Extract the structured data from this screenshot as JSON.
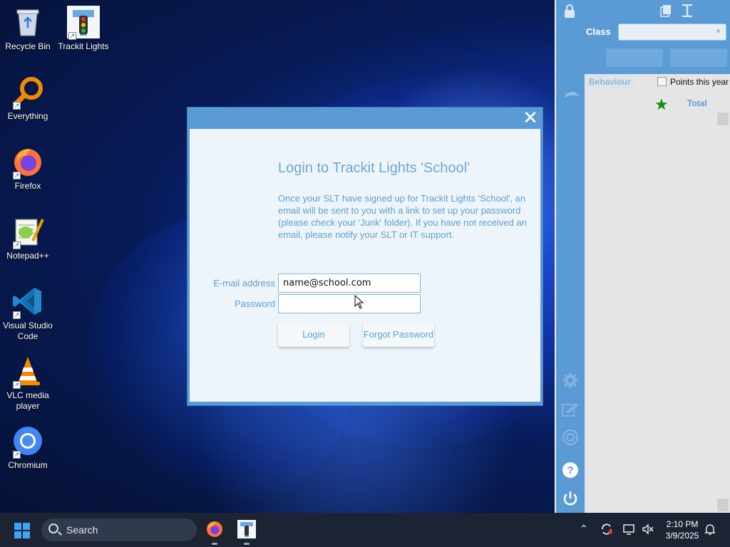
{
  "desktop": {
    "icons": [
      {
        "label": "Recycle Bin",
        "icon": "recycle-bin-icon"
      },
      {
        "label": "Trackit Lights",
        "icon": "traffic-light-icon"
      },
      {
        "label": "Everything",
        "icon": "magnifier-icon"
      },
      {
        "label": "Firefox",
        "icon": "firefox-icon"
      },
      {
        "label": "Notepad++",
        "icon": "notepad-plus-plus-icon"
      },
      {
        "label": "Visual Studio Code",
        "icon": "vscode-icon"
      },
      {
        "label": "VLC media player",
        "icon": "vlc-cone-icon"
      },
      {
        "label": "Chromium",
        "icon": "chromium-icon"
      }
    ]
  },
  "dialog": {
    "title": "Login to Trackit Lights 'School'",
    "message": "Once your SLT have signed up for Trackit Lights 'School', an email will be sent to you with a link to set up your password (please check your 'Junk' folder). If you have not received an email, please notify your SLT or IT support.",
    "email_label": "E-mail address",
    "email_value": "name@school.com",
    "password_label": "Password",
    "password_value": "",
    "login_button": "Login",
    "forgot_button": "Forgot Password",
    "close_symbol": "✕",
    "accent": "#5b9bd5"
  },
  "side_panel": {
    "class_label": "Class",
    "class_value": "",
    "tab_behaviour": "Behaviour",
    "points_label": "Points this year",
    "points_checked": false,
    "total_label": "Total",
    "star_symbol": "★",
    "star_color": "#138a13",
    "icons": [
      "lock-icon",
      "copy-icon",
      "text-cursor-icon",
      "undo-icon",
      "settings-gear-icon",
      "edit-icon",
      "target-icon",
      "help-icon",
      "power-icon"
    ]
  },
  "taskbar": {
    "search_placeholder": "Search",
    "apps": [
      "firefox-icon",
      "trackit-lights-icon"
    ],
    "time": "2:10 PM",
    "date": "3/9/2025",
    "bg": "#1c2433"
  }
}
